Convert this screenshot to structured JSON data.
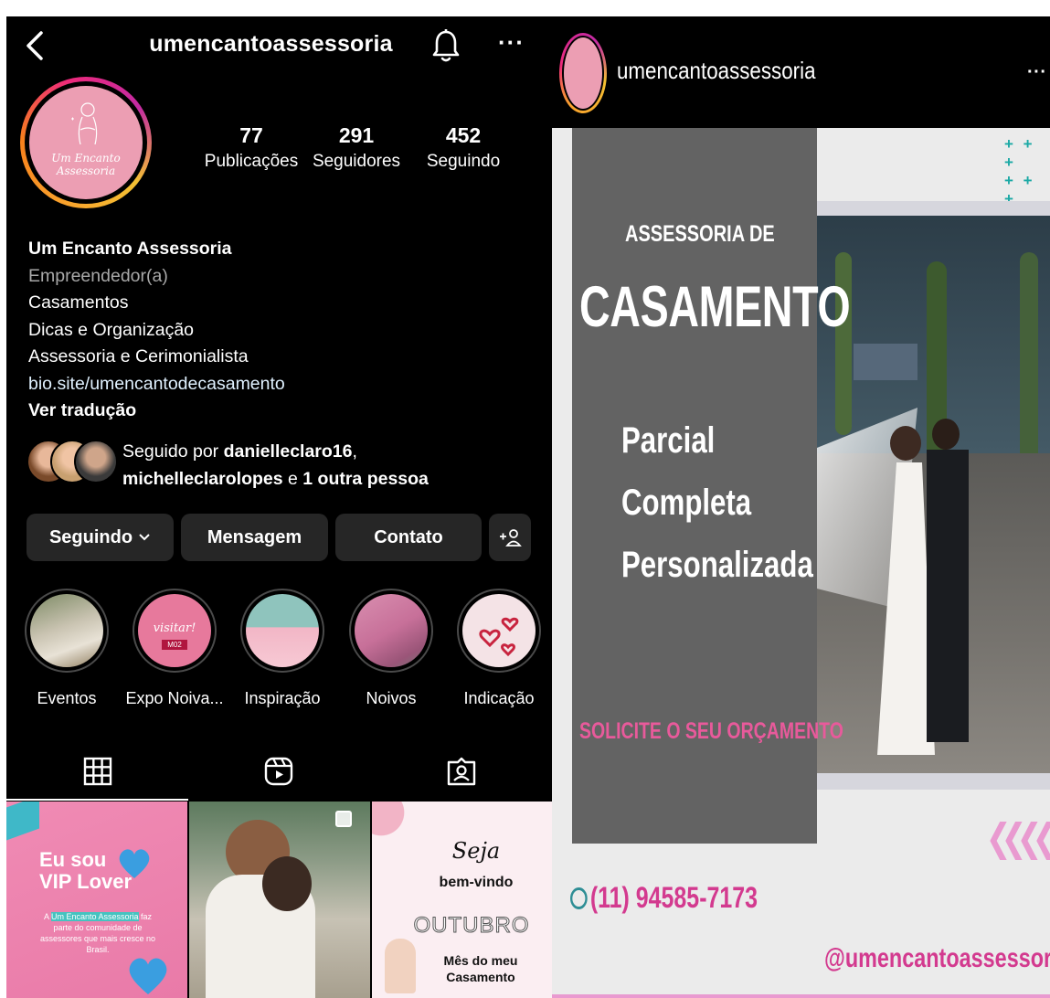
{
  "profile": {
    "username": "umencantoassessoria",
    "avatar_text": "Um Encanto Assessoria",
    "stats": [
      {
        "num": "77",
        "label": "Publicações"
      },
      {
        "num": "291",
        "label": "Seguidores"
      },
      {
        "num": "452",
        "label": "Seguindo"
      }
    ],
    "bio": {
      "name": "Um Encanto Assessoria",
      "category": "Empreendedor(a)",
      "lines": [
        "Casamentos",
        "Dicas e Organização",
        "Assessoria e Cerimonialista"
      ],
      "link": "bio.site/umencantodecasamento",
      "translate": "Ver tradução"
    },
    "followed_by": {
      "prefix": "Seguido por ",
      "user1": "danielleclaro16",
      "comma": ",",
      "user2": "michelleclarolopes",
      "connector": " e ",
      "others": "1 outra pessoa"
    },
    "buttons": {
      "following": "Seguindo",
      "message": "Mensagem",
      "contact": "Contato",
      "add_user": "+"
    },
    "highlights": [
      {
        "label": "Eventos"
      },
      {
        "label": "Expo Noiva..."
      },
      {
        "label": "Inspiração"
      },
      {
        "label": "Noivos"
      },
      {
        "label": "Indicação"
      }
    ],
    "posts": {
      "p1": {
        "line1": "Eu sou",
        "line2": "VIP Lover",
        "highlight": "Um Encanto Assessoria",
        "body": " faz parte do comunidade de assessores que mais cresce no Brasil.",
        "body_prefix": "A "
      },
      "p3": {
        "line1": "Seja",
        "line2": "bem-vindo",
        "line3": "OUTUBRO",
        "line4": "Mês do meu",
        "line5": "Casamento"
      }
    },
    "highlight_inner_text": {
      "visit": "visitar!",
      "code": "M02"
    }
  },
  "story": {
    "username": "umencantoassessoria",
    "title_small": "ASSESSORIA DE",
    "title_big": "CASAMENTO",
    "options": [
      "Parcial",
      "Completa",
      "Personalizada"
    ],
    "cta": "SOLICITE O SEU ORÇAMENTO",
    "phone": "(11) 94585-7173",
    "handle": "@umencantoassessoria",
    "pluses": [
      "+ + +",
      "+ + +"
    ],
    "chevrons": "❮❮❮❮❮"
  },
  "colors": {
    "brand_pink": "#ec9eb3",
    "story_pink": "#d33a8f",
    "teal": "#1ba9a5",
    "button_bg": "#262626"
  }
}
